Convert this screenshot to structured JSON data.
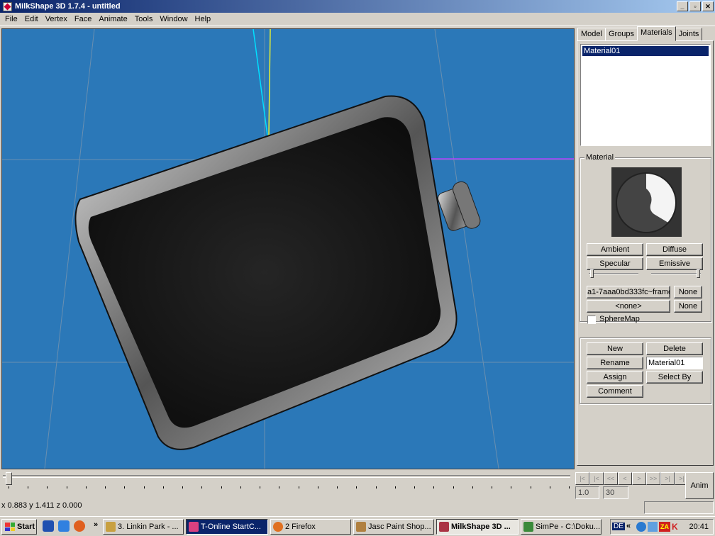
{
  "window": {
    "title": "MilkShape 3D 1.7.4 - untitled",
    "min_label": "_",
    "max_label": "▫",
    "close_label": "✕"
  },
  "menu": [
    "File",
    "Edit",
    "Vertex",
    "Face",
    "Animate",
    "Tools",
    "Window",
    "Help"
  ],
  "tabs": [
    "Model",
    "Groups",
    "Materials",
    "Joints"
  ],
  "active_tab": "Materials",
  "materials": {
    "list": [
      "Material01"
    ],
    "selected": "Material01"
  },
  "material_group": {
    "legend": "Material",
    "ambient": "Ambient",
    "diffuse": "Diffuse",
    "specular": "Specular",
    "emissive": "Emissive",
    "texture": "a1-7aaa0bd333fc~frame",
    "alpha": "<none>",
    "none1": "None",
    "none2": "None",
    "spheremap": "SphereMap",
    "shininess": 0.05,
    "transparency": 0.97
  },
  "actions": {
    "new": "New",
    "delete": "Delete",
    "rename": "Rename",
    "rename_value": "Material01",
    "assign": "Assign",
    "select_by": "Select By",
    "comment": "Comment"
  },
  "timeline": {
    "nav": [
      "|<",
      "|<",
      "<<",
      "<",
      ">",
      ">>",
      ">|",
      ">|"
    ],
    "frame_current": "1.0",
    "frame_total": "30",
    "anim": "Anim"
  },
  "status": {
    "coords": "x 0.883 y 1.411 z 0.000"
  },
  "taskbar": {
    "start": "Start",
    "chevron": "»",
    "tasks": [
      {
        "label": "3. Linkin Park - ...",
        "color": "#c8a040"
      },
      {
        "label": "T-Online StartC...",
        "color": "#d84080"
      },
      {
        "label": "2 Firefox",
        "color": "#e07020"
      },
      {
        "label": "Jasc Paint Shop...",
        "color": "#b08040"
      },
      {
        "label": "MilkShape 3D ...",
        "color": "#aa3344"
      },
      {
        "label": "SimPe - C:\\Doku...",
        "color": "#3a8a3a"
      }
    ],
    "tray_lang": "DE",
    "tray_chevron": "«",
    "tray_za": "ZA",
    "tray_k": "K",
    "clock": "20:41"
  }
}
